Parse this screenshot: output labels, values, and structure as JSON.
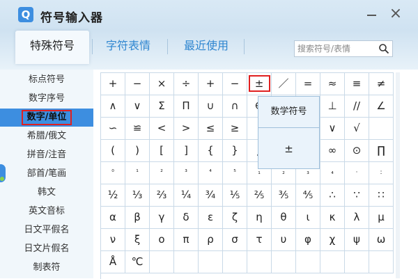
{
  "app": {
    "title": "符号输入器",
    "logo_glyph": "Q"
  },
  "tabs": [
    {
      "label": "特殊符号",
      "active": true
    },
    {
      "label": "字符表情",
      "active": false
    },
    {
      "label": "最近使用",
      "active": false
    }
  ],
  "search": {
    "placeholder": "搜索符号/表情",
    "value": ""
  },
  "sidebar": {
    "items": [
      {
        "label": "标点符号"
      },
      {
        "label": "数字序号"
      },
      {
        "label": "数字/单位",
        "active": true
      },
      {
        "label": "希腊/俄文"
      },
      {
        "label": "拼音/注音"
      },
      {
        "label": "部首/笔画"
      },
      {
        "label": "韩文"
      },
      {
        "label": "英文音标"
      },
      {
        "label": "日文平假名"
      },
      {
        "label": "日文片假名"
      },
      {
        "label": "制表符"
      }
    ]
  },
  "symbol_grid": {
    "rows": [
      [
        "+",
        "−",
        "×",
        "÷",
        "+",
        "−",
        "±",
        "／",
        "=",
        "≈",
        "≡",
        "≠"
      ],
      [
        "∧",
        "∨",
        "Σ",
        "Π",
        "∪",
        "∩",
        "∈",
        "",
        "",
        "⊥",
        "//",
        "∠"
      ],
      [
        "∽",
        "≌",
        "<",
        ">",
        "≤",
        "≥",
        "",
        "",
        "",
        "∨",
        "√",
        ""
      ],
      [
        "(",
        ")",
        "[",
        "]",
        "{",
        "}",
        "∫",
        "",
        "",
        "∞",
        "⊙",
        "∏"
      ],
      [
        "⁰",
        "¹",
        "²",
        "³",
        "⁴",
        "⁵",
        "₁",
        "₂",
        "₃",
        "₄",
        "·",
        ":"
      ],
      [
        "½",
        "⅓",
        "⅔",
        "¼",
        "¾",
        "⅕",
        "⅖",
        "⅗",
        "⅘",
        "∴",
        "∵",
        "∷"
      ],
      [
        "α",
        "β",
        "γ",
        "δ",
        "ε",
        "ζ",
        "η",
        "θ",
        "ι",
        "κ",
        "λ",
        "μ"
      ],
      [
        "ν",
        "ξ",
        "ο",
        "π",
        "ρ",
        "σ",
        "τ",
        "υ",
        "φ",
        "χ",
        "ψ",
        "ω"
      ],
      [
        "Å",
        "℃",
        "",
        "",
        "",
        "",
        "",
        "",
        "",
        "",
        "",
        ""
      ]
    ],
    "selected_symbol": "±"
  },
  "tooltip": {
    "category": "数学符号",
    "symbol": "±"
  },
  "colors": {
    "accent": "#3d8ee0",
    "highlight_border": "#e02020",
    "titlebar": "#d9e9f5"
  },
  "icons": {
    "search": "search-icon",
    "close": "close-icon",
    "minimize": "minimize-icon"
  }
}
